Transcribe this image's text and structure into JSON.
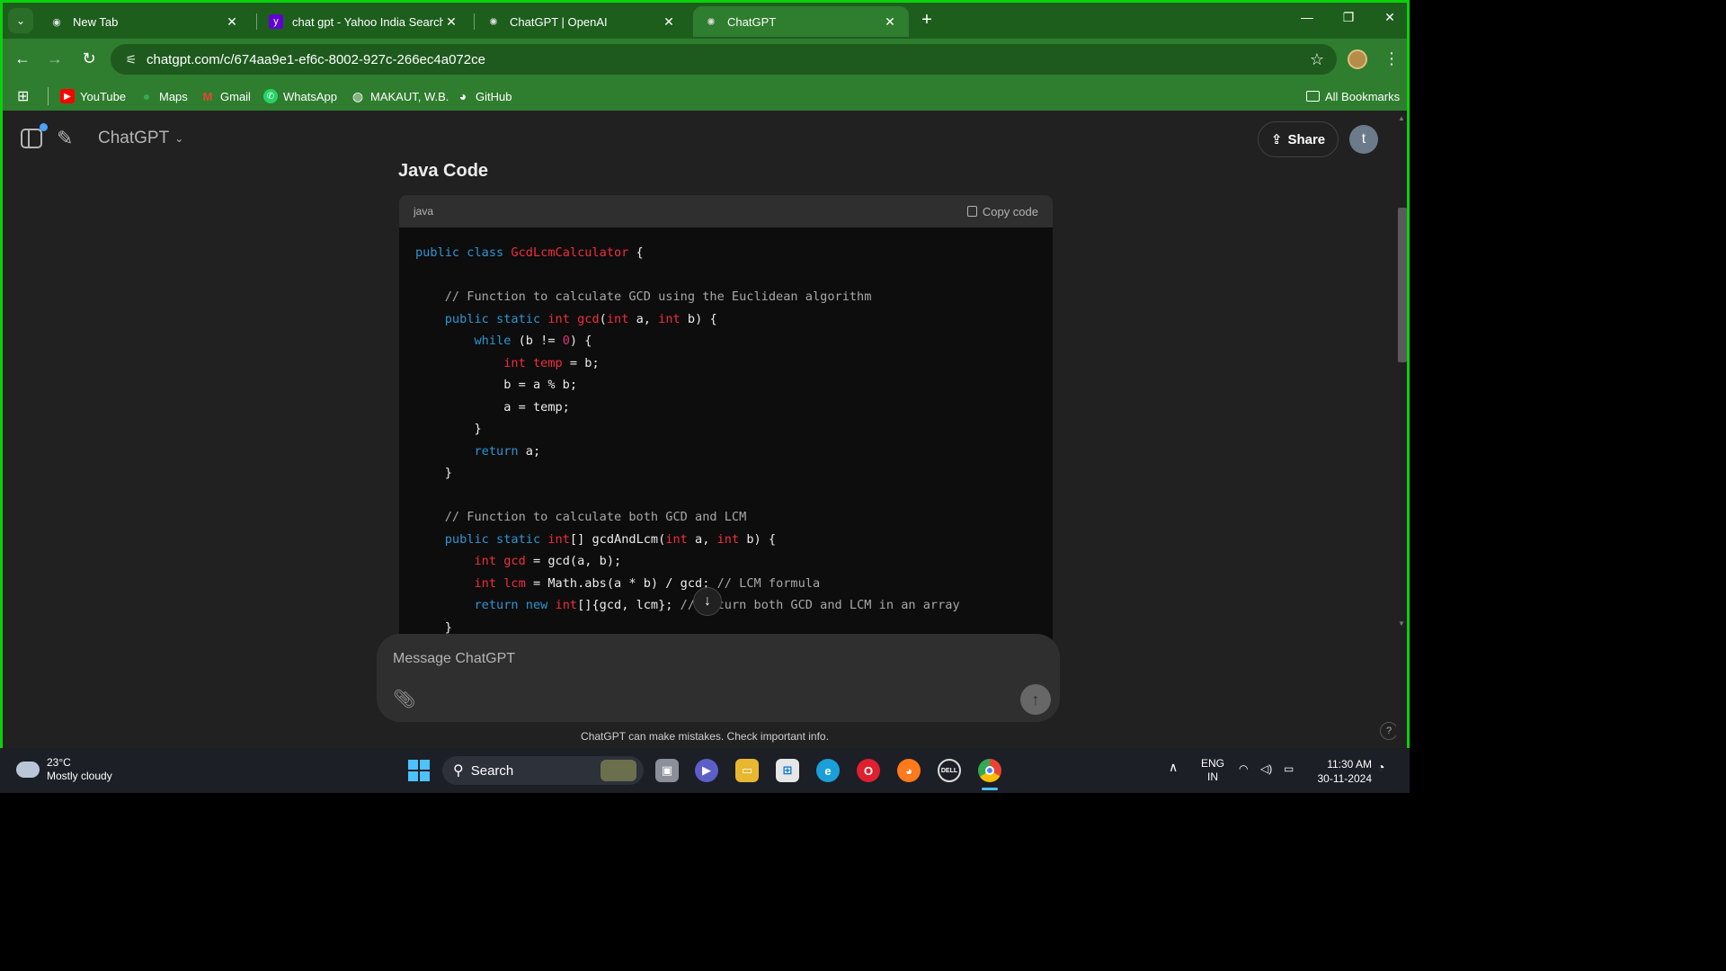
{
  "browser": {
    "tabs": [
      {
        "title": "New Tab",
        "active": false
      },
      {
        "title": "chat gpt - Yahoo India Search R",
        "active": false
      },
      {
        "title": "ChatGPT | OpenAI",
        "active": false
      },
      {
        "title": "ChatGPT",
        "active": true
      }
    ],
    "url": "chatgpt.com/c/674aa9e1-ef6c-8002-927c-266ec4a072ce",
    "bookmarks": [
      {
        "label": "YouTube",
        "icon": "youtube-icon",
        "color": "#ff0000"
      },
      {
        "label": "Maps",
        "icon": "maps-icon",
        "color": "#34a853"
      },
      {
        "label": "Gmail",
        "icon": "gmail-icon",
        "color": "#ea4335"
      },
      {
        "label": "WhatsApp",
        "icon": "whatsapp-icon",
        "color": "#25d366"
      },
      {
        "label": "MAKAUT, W.B.",
        "icon": "globe-icon",
        "color": "#ffffff"
      },
      {
        "label": "GitHub",
        "icon": "github-icon",
        "color": "#ffffff"
      }
    ],
    "all_bookmarks": "All Bookmarks",
    "frame_color": "#0bd10b",
    "theme_color": "#2f7d2f"
  },
  "chat": {
    "model": "ChatGPT",
    "share": "Share",
    "avatar_letter": "t",
    "heading": "Java Code",
    "code_lang": "java",
    "copy_label": "Copy code",
    "composer_placeholder": "Message ChatGPT",
    "disclaimer": "ChatGPT can make mistakes. Check important info.",
    "help": "?"
  },
  "taskbar": {
    "temperature": "23°C",
    "weather": "Mostly cloudy",
    "search": "Search",
    "lang": "ENG",
    "region": "IN",
    "time": "11:30 AM",
    "date": "30-11-2024"
  }
}
